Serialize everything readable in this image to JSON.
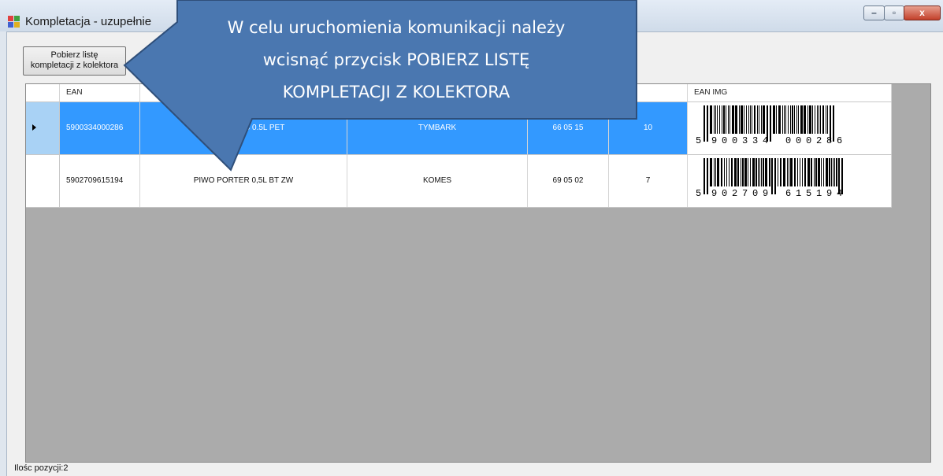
{
  "window": {
    "title": "Kompletacja - uzupełnienie",
    "controls": {
      "minimize": "–",
      "maximize": "▫",
      "close": "x"
    }
  },
  "toolbar": {
    "fetch_button_line1": "Pobierz listę",
    "fetch_button_line2": "kompletacji z kolektora"
  },
  "grid": {
    "columns": [
      "EAN",
      "",
      "",
      "",
      "",
      "EAN IMG"
    ],
    "rows": [
      {
        "ean": "5900334000286",
        "name": "IC WISN-JAB 0.5L PET",
        "producer": "TYMBARK",
        "code": "66 05 15",
        "qty": "10",
        "barcode_digits": [
          "5",
          "9",
          "0",
          "0",
          "3",
          "3",
          "4",
          "0",
          "0",
          "0",
          "2",
          "8",
          "6"
        ],
        "selected": true
      },
      {
        "ean": "5902709615194",
        "name": "PIWO PORTER 0,5L BT ZW",
        "producer": "KOMES",
        "code": "69 05 02",
        "qty": "7",
        "barcode_digits": [
          "5",
          "9",
          "0",
          "2",
          "7",
          "0",
          "9",
          "6",
          "1",
          "5",
          "1",
          "9",
          "4"
        ],
        "selected": false
      }
    ]
  },
  "status": {
    "count_label": "Ilośc pozycji:2"
  },
  "callout": {
    "line1": "W celu uruchomienia komunikacji należy",
    "line2": "wcisnąć przycisk POBIERZ LISTĘ",
    "line3": "KOMPLETACJI Z KOLEKTORA",
    "fill_color": "#4a77b0",
    "border_color": "#2f4f7a"
  }
}
